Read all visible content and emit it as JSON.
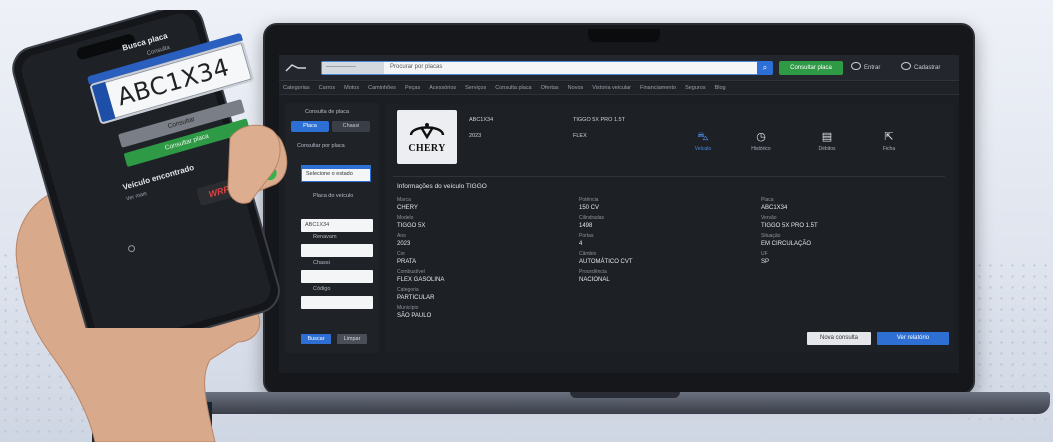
{
  "laptop": {
    "topbar": {
      "search_prefix": "───────",
      "search_text": "Procurar por placas",
      "green_button": "Consultar placa",
      "link1": "Entrar",
      "link2": "Cadastrar"
    },
    "nav": [
      "Categorias",
      "Carros",
      "Motos",
      "Caminhões",
      "Peças",
      "Acessórios",
      "Serviços",
      "Consulta placa",
      "Ofertas",
      "Novos",
      "Vistoria veicular",
      "Financiamento",
      "Seguros",
      "Blog"
    ],
    "left": {
      "title": "Consulta de placa",
      "tab_active": "Placa",
      "tab_inactive": "Chassi",
      "subtitle": "Consultar por placa",
      "select_value": "Selecione o estado",
      "label1": "Placa do veículo",
      "input1": "ABC1X34",
      "label2": "Renavam",
      "input2": "",
      "label3": "Chassi",
      "input3": "",
      "label4": "Código",
      "input4": "",
      "btn_search": "Buscar",
      "btn_clear": "Limpar"
    },
    "main": {
      "brand": "CHERY",
      "info": {
        "l1": "ABC1X34",
        "l2": "2023",
        "r1": "TIGGO 5X PRO 1.5T",
        "r2": "FLEX"
      },
      "actions": [
        {
          "icon": "car",
          "label": "Veículo"
        },
        {
          "icon": "clock",
          "label": "Histórico"
        },
        {
          "icon": "document",
          "label": "Débitos"
        },
        {
          "icon": "share",
          "label": "Ficha"
        }
      ],
      "section_title": "Informações do veículo TIGGO",
      "col1": [
        {
          "label": "Marca",
          "value": "CHERY"
        },
        {
          "label": "Modelo",
          "value": "TIGGO 5X"
        },
        {
          "label": "Ano",
          "value": "2023"
        },
        {
          "label": "Cor",
          "value": "PRATA"
        },
        {
          "label": "Combustível",
          "value": "FLEX GASOLINA"
        },
        {
          "label": "Categoria",
          "value": "PARTICULAR"
        },
        {
          "label": "Município",
          "value": "SÃO PAULO"
        }
      ],
      "col2": [
        {
          "label": "Potência",
          "value": "150 CV"
        },
        {
          "label": "Cilindradas",
          "value": "1498"
        },
        {
          "label": "Portas",
          "value": "4"
        },
        {
          "label": "Câmbio",
          "value": "AUTOMÁTICO CVT"
        },
        {
          "label": "Procedência",
          "value": "NACIONAL"
        }
      ],
      "col3": [
        {
          "label": "Placa",
          "value": "ABC1X34"
        },
        {
          "label": "Versão",
          "value": "TIGGO 5X PRO 1.5T"
        },
        {
          "label": "Situação",
          "value": "EM CIRCULAÇÃO"
        },
        {
          "label": "UF",
          "value": "SP"
        }
      ],
      "footer_btn1": "Nova consulta",
      "footer_btn2": "Ver relatório"
    }
  },
  "phone": {
    "title": "Busca placa",
    "small": "Consulta",
    "plate": "ABC1X34",
    "btn_gray": "Consultar",
    "btn_green": "Consultar placa",
    "caption": "Veículo encontrado",
    "subcaption": "Ver mais",
    "logo_text": "WRF"
  },
  "colors": {
    "accent": "#2d6fd3",
    "green": "#2f9a45",
    "dark": "#1b1e23"
  }
}
